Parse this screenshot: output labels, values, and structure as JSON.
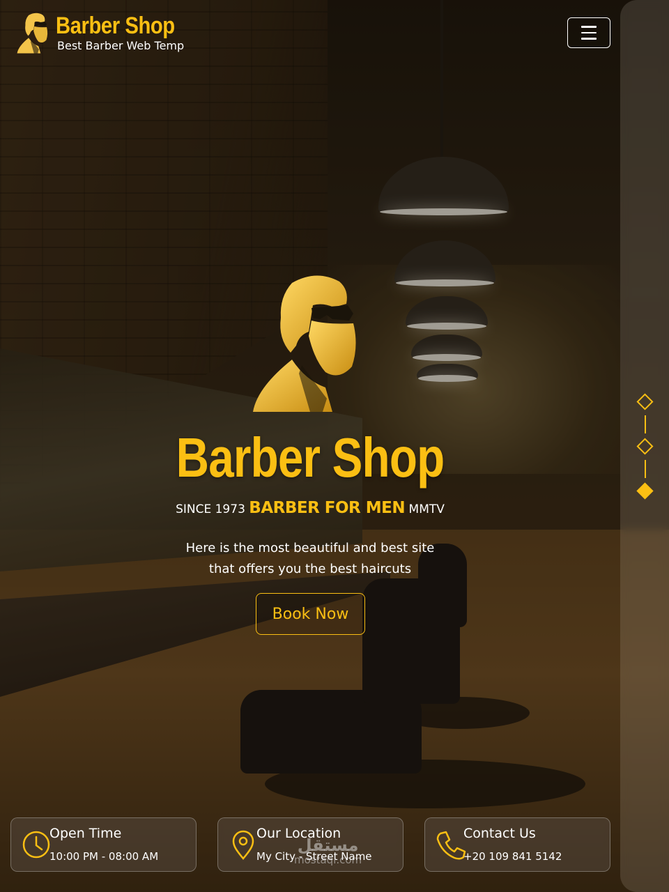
{
  "header": {
    "brand_name": "Barber Shop",
    "brand_tagline": "Best Barber Web Temp",
    "menu_icon": "hamburger-menu-icon"
  },
  "hero": {
    "title": "Barber Shop",
    "subtitle_prefix": "SINCE 1973",
    "subtitle_highlight": "BARBER FOR MEN",
    "subtitle_suffix": "MMTV",
    "description": "Here is the most beautiful and best site that offers you the best haircuts",
    "cta_label": "Book Now"
  },
  "slider_dots": {
    "count": 3,
    "active_index": 2
  },
  "info_cards": [
    {
      "icon": "clock-icon",
      "title": "Open Time",
      "text": "10:00 PM - 08:00 AM"
    },
    {
      "icon": "location-pin-icon",
      "title": "Our Location",
      "text": "My City - Street Name"
    },
    {
      "icon": "phone-icon",
      "title": "Contact Us",
      "text": "+20 109 841 5142"
    }
  ],
  "watermark": {
    "arabic": "مستقل",
    "latin": "mostaql.com"
  },
  "colors": {
    "accent": "#fbbf13",
    "text": "#ffffff",
    "card_bg": "rgba(90,80,70,0.45)"
  }
}
